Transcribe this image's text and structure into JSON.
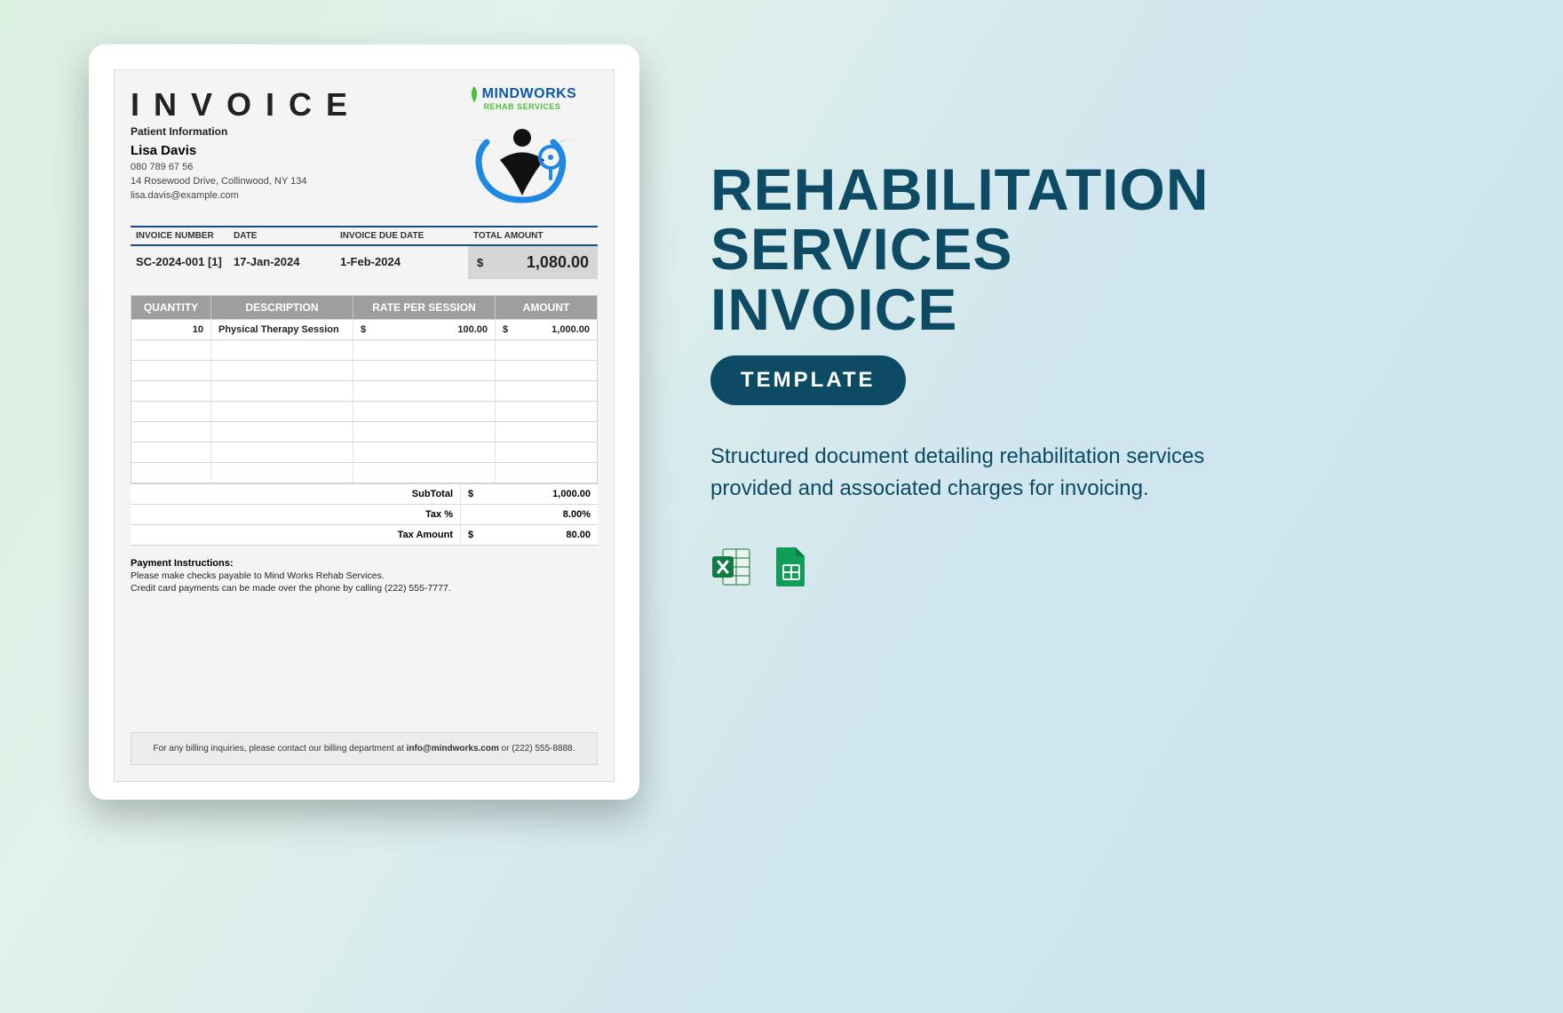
{
  "invoice": {
    "title": "INVOICE",
    "logo": {
      "line1": "MINDWORKS",
      "line2": "REHAB SERVICES"
    },
    "patient": {
      "heading": "Patient Information",
      "name": "Lisa Davis",
      "phone": "080 789 67 56",
      "address": "14 Rosewood Drive, Collinwood,  NY 134",
      "email": "lisa.davis@example.com"
    },
    "meta": {
      "headers": {
        "number": "INVOICE NUMBER",
        "date": "DATE",
        "due": "INVOICE DUE DATE",
        "total": "TOTAL AMOUNT"
      },
      "number": "SC-2024-001 [1]",
      "date": "17-Jan-2024",
      "due": "1-Feb-2024",
      "total_symbol": "$",
      "total_value": "1,080.00"
    },
    "table": {
      "headers": {
        "qty": "QUANTITY",
        "desc": "DESCRIPTION",
        "rate": "RATE PER SESSION",
        "amount": "AMOUNT"
      },
      "row": {
        "qty": "10",
        "desc": "Physical Therapy Session",
        "rate_sym": "$",
        "rate_val": "100.00",
        "amt_sym": "$",
        "amt_val": "1,000.00"
      }
    },
    "summary": {
      "sub_label": "SubTotal",
      "sub_sym": "$",
      "sub_val": "1,000.00",
      "tax_label": "Tax %",
      "tax_val": "8.00%",
      "taxamt_label": "Tax Amount",
      "taxamt_sym": "$",
      "taxamt_val": "80.00"
    },
    "payment": {
      "heading": "Payment Instructions:",
      "l1": "Please make checks payable to Mind Works Rehab Services.",
      "l2": "Credit card payments can be made over the phone by calling (222) 555-7777."
    },
    "footer": {
      "pre": "For any billing inquiries, please contact our billing department at ",
      "email": "info@mindworks.com",
      "post": " or (222) 555-8888."
    }
  },
  "promo": {
    "title_l1": "REHABILITATION",
    "title_l2": "SERVICES",
    "title_l3": "INVOICE",
    "pill": "TEMPLATE",
    "desc": "Structured document detailing rehabilitation services provided and associated charges for invoicing."
  }
}
